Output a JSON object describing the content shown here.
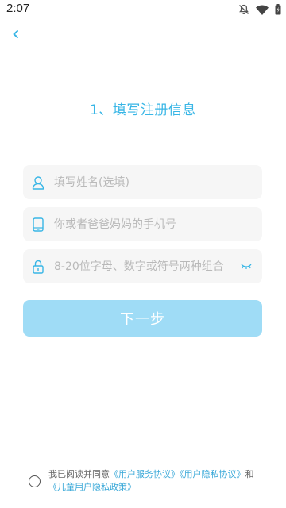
{
  "status_bar": {
    "time": "2:07"
  },
  "page": {
    "title": "1、填写注册信息"
  },
  "form": {
    "name_placeholder": "填写姓名(选填)",
    "phone_placeholder": "你或者爸爸妈妈的手机号",
    "password_placeholder": "8-20位字母、数字或符号两种组合",
    "next_label": "下一步"
  },
  "agreement": {
    "prefix": "我已阅读并同意",
    "user_service": "《用户服务协议》",
    "user_privacy": "《用户隐私协议》",
    "and": "和",
    "child_privacy": "《儿童用户隐私政策》"
  },
  "colors": {
    "accent": "#39b6e6",
    "button_disabled": "#9fdcf6",
    "field_bg": "#f6f6f6"
  },
  "icons": [
    "bell-off-icon",
    "wifi-icon",
    "battery-icon",
    "back-chevron-icon",
    "user-icon",
    "phone-icon",
    "lock-icon",
    "eye-closed-icon"
  ]
}
